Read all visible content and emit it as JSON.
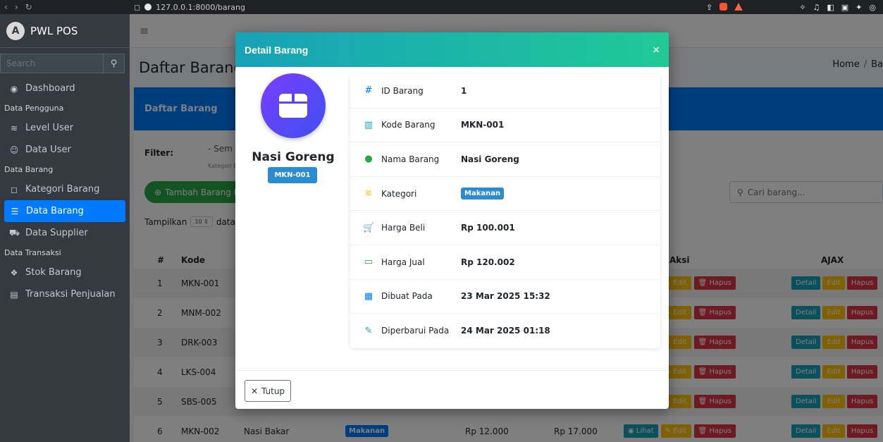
{
  "browser": {
    "url": "127.0.0.1:8000/barang"
  },
  "brand": {
    "name": "PWL POS",
    "logo": "A"
  },
  "sidebar": {
    "search_placeholder": "Search",
    "items": [
      {
        "type": "item",
        "label": "Dashboard",
        "icon": "dashboard-icon"
      },
      {
        "type": "header",
        "label": "Data Pengguna"
      },
      {
        "type": "item",
        "label": "Level User",
        "icon": "layer-icon"
      },
      {
        "type": "item",
        "label": "Data User",
        "icon": "user-icon"
      },
      {
        "type": "header",
        "label": "Data Barang"
      },
      {
        "type": "item",
        "label": "Kategori Barang",
        "icon": "bookmark-icon"
      },
      {
        "type": "item",
        "label": "Data Barang",
        "icon": "list-icon",
        "active": true
      },
      {
        "type": "item",
        "label": "Data Supplier",
        "icon": "truck-icon"
      },
      {
        "type": "header",
        "label": "Data Transaksi"
      },
      {
        "type": "item",
        "label": "Stok Barang",
        "icon": "cubes-icon"
      },
      {
        "type": "item",
        "label": "Transaksi Penjualan",
        "icon": "cash-register-icon"
      }
    ]
  },
  "page": {
    "title": "Daftar Barang",
    "breadcrumb_home": "Home",
    "breadcrumb_current": "Ba",
    "card_title": "Daftar Barang",
    "filter_label": "Filter:",
    "filter_select": "- Sem",
    "filter_hint": "Kategori B",
    "add_button": "Tambah Barang Ba",
    "show_label": "Tampilkan",
    "show_value": "10",
    "show_suffix": "data p",
    "search_placeholder": "Cari barang..."
  },
  "table": {
    "headers": {
      "no": "#",
      "kode": "Kode",
      "aksi": "Aksi",
      "ajax": "AJAX"
    },
    "rows": [
      {
        "no": "1",
        "kode": "MKN-001"
      },
      {
        "no": "2",
        "kode": "MNM-002"
      },
      {
        "no": "3",
        "kode": "DRK-003"
      },
      {
        "no": "4",
        "kode": "LKS-004"
      },
      {
        "no": "5",
        "kode": "SBS-005"
      },
      {
        "no": "6",
        "kode": "MKN-002",
        "nama": "Nasi Bakar",
        "kategori": "Makanan",
        "harga_beli": "Rp 12.000",
        "harga_jual": "Rp 17.000"
      }
    ],
    "actions": {
      "lihat": "Lihat",
      "edit": "Edit",
      "hapus": "Hapus",
      "detail": "Detail"
    }
  },
  "modal": {
    "title": "Detail Barang",
    "close": "×",
    "product_name": "Nasi Goreng",
    "product_code": "MKN-001",
    "details": [
      {
        "icon": "hash-icon",
        "glyph": "#",
        "color": "#007bff",
        "label": "ID Barang",
        "value": "1"
      },
      {
        "icon": "barcode-icon",
        "glyph": "▥",
        "color": "#17a2b8",
        "label": "Kode Barang",
        "value": "MKN-001"
      },
      {
        "icon": "tag-icon",
        "glyph": "●",
        "color": "#28a745",
        "label": "Nama Barang",
        "value": "Nasi Goreng"
      },
      {
        "icon": "layer-group-icon",
        "glyph": "≋",
        "color": "#ffc107",
        "label": "Kategori",
        "value": "Makanan",
        "badge": true
      },
      {
        "icon": "cart-icon",
        "glyph": "🛒",
        "color": "#dc3545",
        "label": "Harga Beli",
        "value": "Rp 100.001"
      },
      {
        "icon": "money-icon",
        "glyph": "▭",
        "color": "#28a745",
        "label": "Harga Jual",
        "value": "Rp 120.002"
      },
      {
        "icon": "calendar-icon",
        "glyph": "▦",
        "color": "#007bff",
        "label": "Dibuat Pada",
        "value": "23 Mar 2025 15:32"
      },
      {
        "icon": "edit-icon",
        "glyph": "✎",
        "color": "#17a2b8",
        "label": "Diperbarui Pada",
        "value": "24 Mar 2025 01:18"
      }
    ],
    "close_button": "Tutup"
  }
}
